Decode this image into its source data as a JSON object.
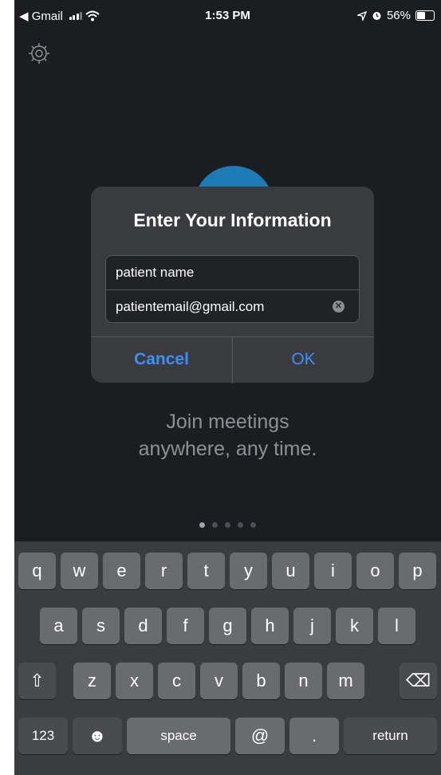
{
  "status_bar": {
    "back_label": "◀ Gmail",
    "time": "1:53 PM",
    "battery_percent": "56%",
    "icons": [
      "signal-bars-icon",
      "wifi-icon",
      "location-arrow-icon",
      "alarm-icon",
      "battery-icon"
    ]
  },
  "settings": {
    "icon": "gear-icon"
  },
  "dialog": {
    "title": "Enter Your Information",
    "name_value": "patient name",
    "email_value": "patientemail@gmail.com",
    "clear_icon": "✕",
    "cancel_label": "Cancel",
    "ok_label": "OK"
  },
  "tagline": {
    "line1": "Join meetings",
    "line2": "anywhere, any time."
  },
  "pager": {
    "count": 5,
    "active_index": 0
  },
  "keyboard": {
    "row1": [
      "q",
      "w",
      "e",
      "r",
      "t",
      "y",
      "u",
      "i",
      "o",
      "p"
    ],
    "row2": [
      "a",
      "s",
      "d",
      "f",
      "g",
      "h",
      "j",
      "k",
      "l"
    ],
    "row3": [
      "z",
      "x",
      "c",
      "v",
      "b",
      "n",
      "m"
    ],
    "shift_icon": "⇧",
    "delete_icon": "⌫",
    "numbers_label": "123",
    "emoji_icon": "☻",
    "space_label": "space",
    "at_label": "@",
    "dot_label": ".",
    "return_label": "return"
  },
  "colors": {
    "background": "#1b1d20",
    "dialog": "#3a3b3f",
    "accent": "#3e8ef5",
    "logo": "#1f7bb5",
    "keyboard": "#3b3c3e"
  }
}
